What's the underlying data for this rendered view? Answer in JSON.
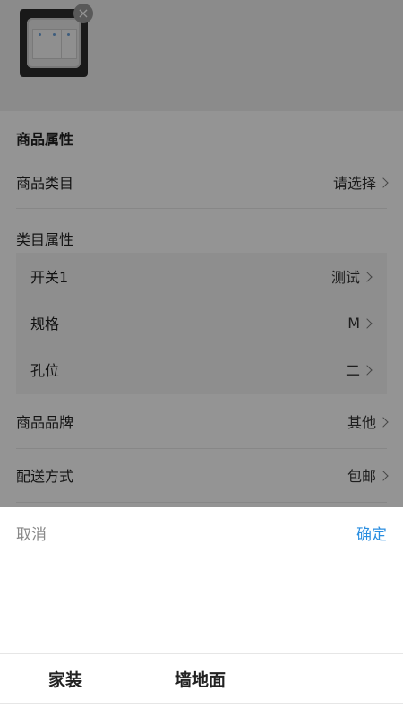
{
  "product_attrs": {
    "title": "商品属性",
    "category": {
      "label": "商品类目",
      "value": "请选择"
    },
    "category_attrs_label": "类目属性",
    "category_attrs": [
      {
        "label": "开关1",
        "value": "测试"
      },
      {
        "label": "规格",
        "value": "M"
      },
      {
        "label": "孔位",
        "value": "二"
      }
    ],
    "brand": {
      "label": "商品品牌",
      "value": "其他"
    },
    "delivery": {
      "label": "配送方式",
      "value": "包邮"
    }
  },
  "picker": {
    "cancel_label": "取消",
    "confirm_label": "确定",
    "tabs": [
      "家装",
      "墙地面"
    ],
    "confirm_color": "#2a8ee0"
  },
  "icons": {
    "remove": "close-icon",
    "chevron": "chevron-right-icon"
  }
}
